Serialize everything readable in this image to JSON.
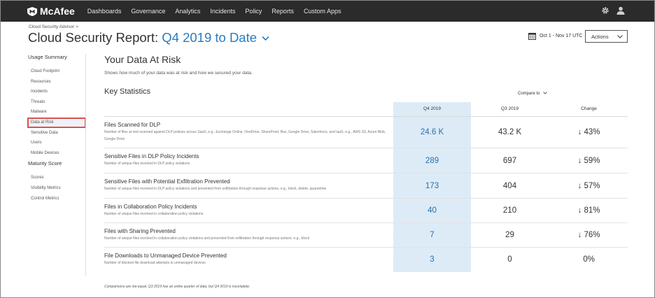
{
  "brand": {
    "name": "McAfee"
  },
  "nav": [
    "Dashboards",
    "Governance",
    "Analytics",
    "Incidents",
    "Policy",
    "Reports",
    "Custom Apps"
  ],
  "icons": {
    "settings": "gear-icon",
    "user": "user-icon",
    "calendar": "calendar-icon",
    "chevron": "chevron-down-icon",
    "arrow_down": "arrow-down-icon"
  },
  "breadcrumb": "Cloud Security Advisor  >",
  "header": {
    "title": "Cloud Security Report:",
    "period": "Q4 2019 to Date",
    "date_range": "Oct 1 - Nov 17 UTC",
    "actions_label": "Actions"
  },
  "sidebar": {
    "section1": "Usage Summary",
    "items1": [
      "Cloud Footprint",
      "Resources",
      "Incidents",
      "Threats",
      "Malware",
      "Data at Risk",
      "Sensitive Data",
      "Users",
      "Mobile Devices"
    ],
    "section2": "Maturity Score",
    "items2": [
      "Scores",
      "Visibility Metrics",
      "Control Metrics"
    ],
    "active": "Data at Risk"
  },
  "main": {
    "title": "Your Data At Risk",
    "subtitle": "Shows how much of your data was at risk and how we secured your data.",
    "key_stats": "Key Statistics",
    "compare_to": "Compare to",
    "columns": [
      "Q4 2019",
      "Q3 2019",
      "Change"
    ],
    "rows": [
      {
        "title": "Files Scanned for DLP",
        "desc": "Number of files at rest scanned against DLP policies across SaaS, e.g., Exchange Online, OneDrive, SharePoint, Box, Google Drive, Salesforce, and IaaS, e.g., AWS S3, Azure Blob, Google Drive",
        "q4": "24.6 K",
        "q3": "43.2 K",
        "change": "43%"
      },
      {
        "title": "Sensitive Files in DLP Policy Incidents",
        "desc": "Number of unique files involved in DLP policy violations",
        "q4": "289",
        "q3": "697",
        "change": "59%"
      },
      {
        "title": "Sensitive Files with Potential Exfiltration Prevented",
        "desc": "Number of unique files involved in DLP policy violations and prevented from exfiltration through response actions, e.g., block, delete, quarantine",
        "q4": "173",
        "q3": "404",
        "change": "57%"
      },
      {
        "title": "Files in Collaboration Policy Incidents",
        "desc": "Number of unique files involved in collaboration policy violations",
        "q4": "40",
        "q3": "210",
        "change": "81%"
      },
      {
        "title": "Files with Sharing Prevented",
        "desc": "Number of unique files involved in collaboration policy violations and prevented from exfiltration through response actions: e.g., block",
        "q4": "7",
        "q3": "29",
        "change": "76%"
      },
      {
        "title": "File Downloads to Unmanaged Device Prevented",
        "desc": "Number of blocked file download attempts to unmanaged devices",
        "q4": "3",
        "q3": "0",
        "change": "0%"
      }
    ],
    "footnote": "Comparisons are not equal. Q3 2019 has an entire quarter of data, but Q4 2019 is incomplete."
  }
}
